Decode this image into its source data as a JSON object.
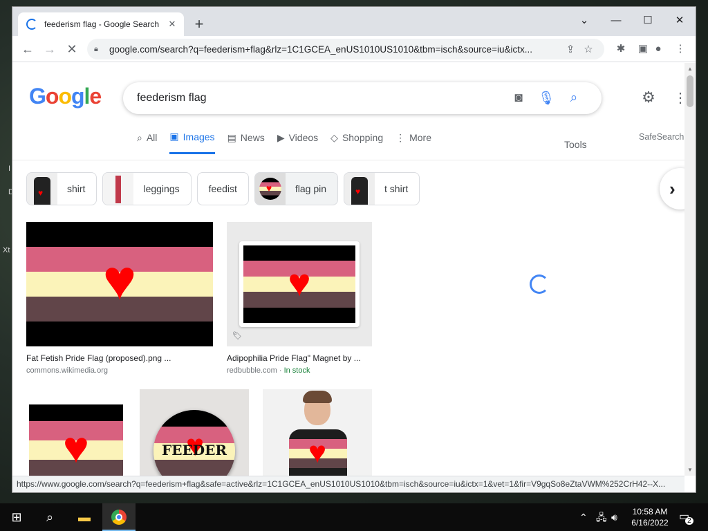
{
  "desktop": {
    "mark1": "I",
    "mark2": "D",
    "mark3": "Xt"
  },
  "browser": {
    "tab_title": "feederism flag - Google Search",
    "url": "google.com/search?q=feederism+flag&rlz=1C1GCEA_enUS1010US1010&tbm=isch&source=iu&ictx...",
    "status_url": "https://www.google.com/search?q=feederism+flag&safe=active&rlz=1C1GCEA_enUS1010US1010&tbm=isch&source=iu&ictx=1&vet=1&fir=V9gqSo8eZtaVWM%252CrH42--X..."
  },
  "google": {
    "logo": [
      "G",
      "o",
      "o",
      "g",
      "l",
      "e"
    ],
    "logo_colors": [
      "#4285f4",
      "#ea4335",
      "#fbbc05",
      "#4285f4",
      "#34a853",
      "#ea4335"
    ],
    "query": "feederism flag",
    "tabs": [
      {
        "label": "All",
        "icon": "search-icon",
        "active": false
      },
      {
        "label": "Images",
        "icon": "image-icon",
        "active": true
      },
      {
        "label": "News",
        "icon": "news-icon",
        "active": false
      },
      {
        "label": "Videos",
        "icon": "video-icon",
        "active": false
      },
      {
        "label": "Shopping",
        "icon": "tag-icon",
        "active": false
      },
      {
        "label": "More",
        "icon": "more-icon",
        "active": false
      }
    ],
    "tools": "Tools",
    "safesearch": "SafeSearch",
    "chips": [
      {
        "label": "shirt"
      },
      {
        "label": "leggings"
      },
      {
        "label": "feedist"
      },
      {
        "label": "flag pin"
      },
      {
        "label": "t shirt"
      }
    ],
    "results": [
      {
        "title": "Fat Fetish Pride Flag (proposed).png ...",
        "source": "commons.wikimedia.org",
        "stock": ""
      },
      {
        "title": "Adipophilia Pride Flag\" Magnet by ...",
        "source": "redbubble.com",
        "stock": "In stock"
      }
    ],
    "button_text": "FEEDER",
    "flag_colors": {
      "black": "#000000",
      "pink": "#d8617f",
      "cream": "#fbf3b9",
      "brown": "#614549",
      "heart": "#ff0000"
    }
  },
  "taskbar": {
    "time": "10:58 AM",
    "date": "6/16/2022",
    "notifications": "2"
  }
}
